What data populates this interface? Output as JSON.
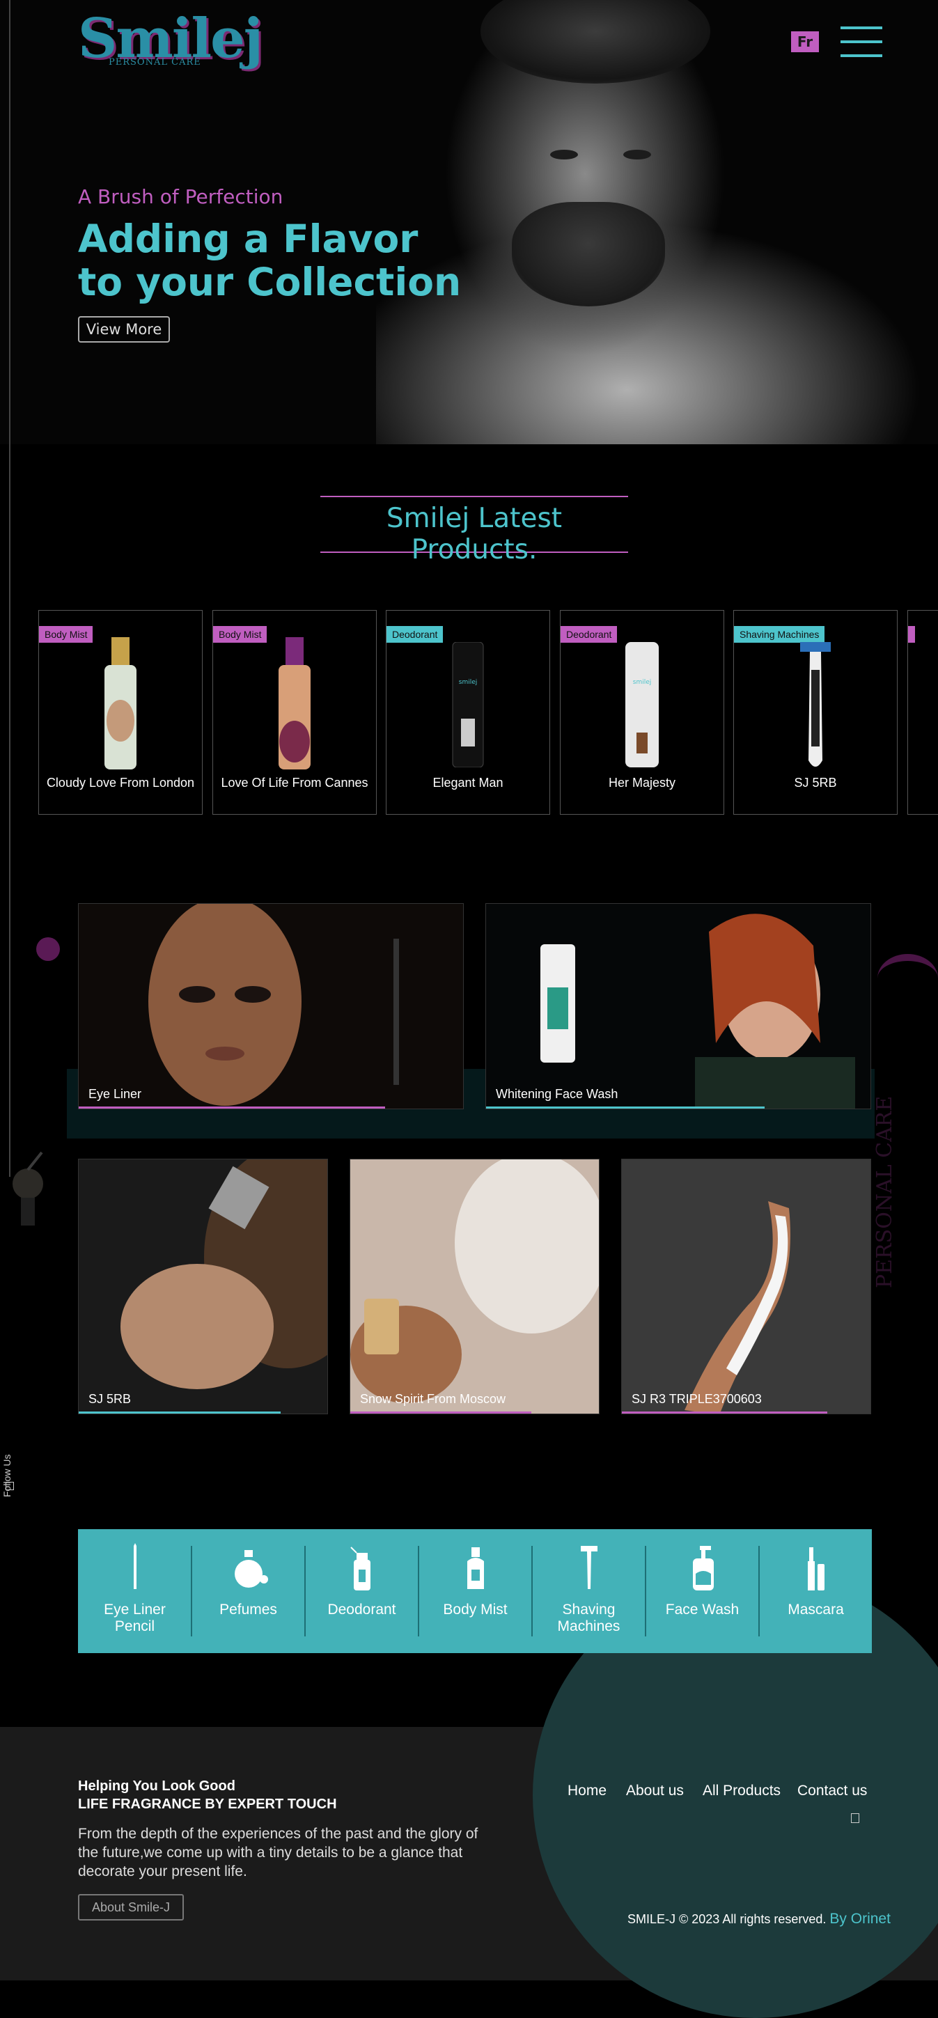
{
  "header": {
    "logo_text": "Smilej",
    "logo_tagline": "PERSONAL CARE",
    "lang_button": "Fr",
    "menu_icon": "hamburger-icon"
  },
  "hero": {
    "subtitle": "A Brush of Perfection",
    "title_line1": "Adding a Flavor",
    "title_line2": "to your Collection",
    "button": "View More"
  },
  "side": {
    "follow_label": "Follow Us"
  },
  "latest": {
    "title": "Smilej Latest Products.",
    "products": [
      {
        "tag": "Body Mist",
        "tag_color": "#c05ec0",
        "name": "Cloudy Love From London"
      },
      {
        "tag": "Body Mist",
        "tag_color": "#c05ec0",
        "name": "Love Of Life From Cannes"
      },
      {
        "tag": "Deodorant",
        "tag_color": "#4dc4cc",
        "name": "Elegant Man"
      },
      {
        "tag": "Deodorant",
        "tag_color": "#c05ec0",
        "name": "Her Majesty"
      },
      {
        "tag": "Shaving Machines",
        "tag_color": "#4dc4cc",
        "name": "SJ 5RB"
      }
    ]
  },
  "features": [
    {
      "label": "Eye Liner",
      "bar_color": "#c05ec0"
    },
    {
      "label": "Whitening Face Wash",
      "bar_color": "#4dc4cc"
    },
    {
      "label": "SJ 5RB",
      "bar_color": "#4dc4cc"
    },
    {
      "label": "Snow Spirit From Moscow",
      "bar_color": "#c05ec0"
    },
    {
      "label": "SJ R3 TRIPLE3700603",
      "bar_color": "#c05ec0"
    }
  ],
  "categories": [
    {
      "line1": "Eye Liner",
      "line2": "Pencil",
      "icon": "eyeliner-pencil-icon"
    },
    {
      "line1": "Pefumes",
      "line2": "",
      "icon": "perfume-bottle-icon"
    },
    {
      "line1": "Deodorant",
      "line2": "",
      "icon": "deodorant-spray-icon"
    },
    {
      "line1": "Body Mist",
      "line2": "",
      "icon": "body-mist-bottle-icon"
    },
    {
      "line1": "Shaving",
      "line2": "Machines",
      "icon": "razor-icon"
    },
    {
      "line1": "Face Wash",
      "line2": "",
      "icon": "face-wash-pump-icon"
    },
    {
      "line1": "Mascara",
      "line2": "",
      "icon": "mascara-icon"
    }
  ],
  "footer": {
    "heading1": "Helping You Look Good",
    "heading2": "LIFE FRAGRANCE BY EXPERT TOUCH",
    "paragraph": "From the depth of the experiences of the past and the glory of the future,we come up with a tiny details to be a glance that decorate your present life.",
    "about_button": "About Smile-J",
    "nav": [
      "Home",
      "About us",
      "All Products",
      "Contact us"
    ],
    "copyright": "SMILE-J © 2023 All rights reserved.",
    "by": "By Orinet"
  },
  "colors": {
    "teal": "#4dc4cc",
    "magenta": "#c05ec0",
    "category_bar": "#43b2b8",
    "footer_bg": "#1b1b1b"
  }
}
